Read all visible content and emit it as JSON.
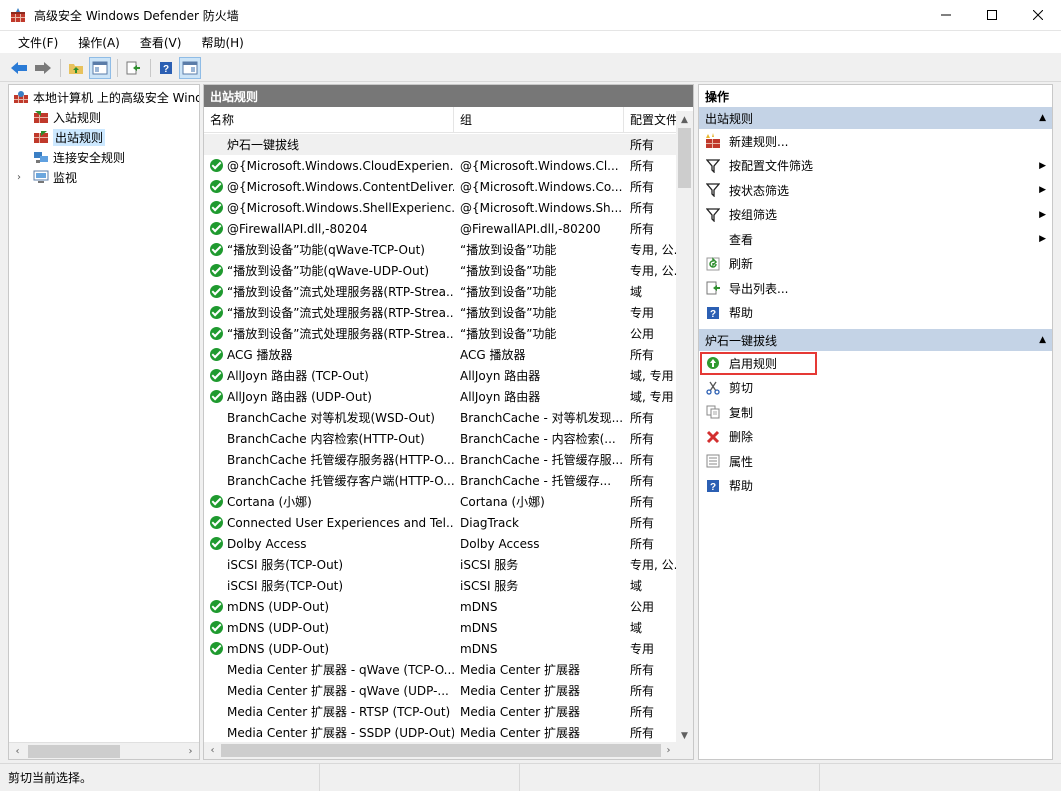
{
  "window": {
    "title": "高级安全 Windows Defender 防火墙"
  },
  "menu": [
    "文件(F)",
    "操作(A)",
    "查看(V)",
    "帮助(H)"
  ],
  "tree": {
    "root": "本地计算机 上的高级安全 Windows Defender 防火墙",
    "items": [
      "入站规则",
      "出站规则",
      "连接安全规则",
      "监视"
    ]
  },
  "middle": {
    "header": "出站规则",
    "columns": [
      "名称",
      "组",
      "配置文件"
    ],
    "rows": [
      {
        "enabled": false,
        "name": "炉石一键拔线",
        "group": "",
        "profile": "所有"
      },
      {
        "enabled": true,
        "name": "@{Microsoft.Windows.CloudExperien...",
        "group": "@{Microsoft.Windows.Cl...",
        "profile": "所有"
      },
      {
        "enabled": true,
        "name": "@{Microsoft.Windows.ContentDeliver...",
        "group": "@{Microsoft.Windows.Co...",
        "profile": "所有"
      },
      {
        "enabled": true,
        "name": "@{Microsoft.Windows.ShellExperienc...",
        "group": "@{Microsoft.Windows.Sh...",
        "profile": "所有"
      },
      {
        "enabled": true,
        "name": "@FirewallAPI.dll,-80204",
        "group": "@FirewallAPI.dll,-80200",
        "profile": "所有"
      },
      {
        "enabled": true,
        "name": "“播放到设备”功能(qWave-TCP-Out)",
        "group": "“播放到设备”功能",
        "profile": "专用, 公..."
      },
      {
        "enabled": true,
        "name": "“播放到设备”功能(qWave-UDP-Out)",
        "group": "“播放到设备”功能",
        "profile": "专用, 公..."
      },
      {
        "enabled": true,
        "name": "“播放到设备”流式处理服务器(RTP-Strea...",
        "group": "“播放到设备”功能",
        "profile": "域"
      },
      {
        "enabled": true,
        "name": "“播放到设备”流式处理服务器(RTP-Strea...",
        "group": "“播放到设备”功能",
        "profile": "专用"
      },
      {
        "enabled": true,
        "name": "“播放到设备”流式处理服务器(RTP-Strea...",
        "group": "“播放到设备”功能",
        "profile": "公用"
      },
      {
        "enabled": true,
        "name": "ACG 播放器",
        "group": "ACG 播放器",
        "profile": "所有"
      },
      {
        "enabled": true,
        "name": "AllJoyn 路由器 (TCP-Out)",
        "group": "AllJoyn 路由器",
        "profile": "域, 专用"
      },
      {
        "enabled": true,
        "name": "AllJoyn 路由器 (UDP-Out)",
        "group": "AllJoyn 路由器",
        "profile": "域, 专用"
      },
      {
        "enabled": false,
        "name": "BranchCache 对等机发现(WSD-Out)",
        "group": "BranchCache - 对等机发现...",
        "profile": "所有"
      },
      {
        "enabled": false,
        "name": "BranchCache 内容检索(HTTP-Out)",
        "group": "BranchCache - 内容检索(...",
        "profile": "所有"
      },
      {
        "enabled": false,
        "name": "BranchCache 托管缓存服务器(HTTP-O...",
        "group": "BranchCache - 托管缓存服...",
        "profile": "所有"
      },
      {
        "enabled": false,
        "name": "BranchCache 托管缓存客户端(HTTP-O...",
        "group": "BranchCache - 托管缓存...",
        "profile": "所有"
      },
      {
        "enabled": true,
        "name": "Cortana (小娜)",
        "group": "Cortana (小娜)",
        "profile": "所有"
      },
      {
        "enabled": true,
        "name": "Connected User Experiences and Tel...",
        "group": "DiagTrack",
        "profile": "所有"
      },
      {
        "enabled": true,
        "name": "Dolby Access",
        "group": "Dolby Access",
        "profile": "所有"
      },
      {
        "enabled": false,
        "name": "iSCSI 服务(TCP-Out)",
        "group": "iSCSI 服务",
        "profile": "专用, 公..."
      },
      {
        "enabled": false,
        "name": "iSCSI 服务(TCP-Out)",
        "group": "iSCSI 服务",
        "profile": "域"
      },
      {
        "enabled": true,
        "name": "mDNS (UDP-Out)",
        "group": "mDNS",
        "profile": "公用"
      },
      {
        "enabled": true,
        "name": "mDNS (UDP-Out)",
        "group": "mDNS",
        "profile": "域"
      },
      {
        "enabled": true,
        "name": "mDNS (UDP-Out)",
        "group": "mDNS",
        "profile": "专用"
      },
      {
        "enabled": false,
        "name": "Media Center 扩展器 - qWave (TCP-O...",
        "group": "Media Center 扩展器",
        "profile": "所有"
      },
      {
        "enabled": false,
        "name": "Media Center 扩展器 - qWave (UDP-...",
        "group": "Media Center 扩展器",
        "profile": "所有"
      },
      {
        "enabled": false,
        "name": "Media Center 扩展器 - RTSP (TCP-Out)",
        "group": "Media Center 扩展器",
        "profile": "所有"
      },
      {
        "enabled": false,
        "name": "Media Center 扩展器 - SSDP (UDP-Out)",
        "group": "Media Center 扩展器",
        "profile": "所有"
      }
    ]
  },
  "actions": {
    "header": "操作",
    "section1": {
      "title": "出站规则",
      "items": [
        "新建规则...",
        "按配置文件筛选",
        "按状态筛选",
        "按组筛选",
        "查看",
        "刷新",
        "导出列表...",
        "帮助"
      ]
    },
    "section2": {
      "title": "炉石一键拔线",
      "items": [
        "启用规则",
        "剪切",
        "复制",
        "删除",
        "属性",
        "帮助"
      ]
    }
  },
  "status": {
    "text": "剪切当前选择。"
  }
}
